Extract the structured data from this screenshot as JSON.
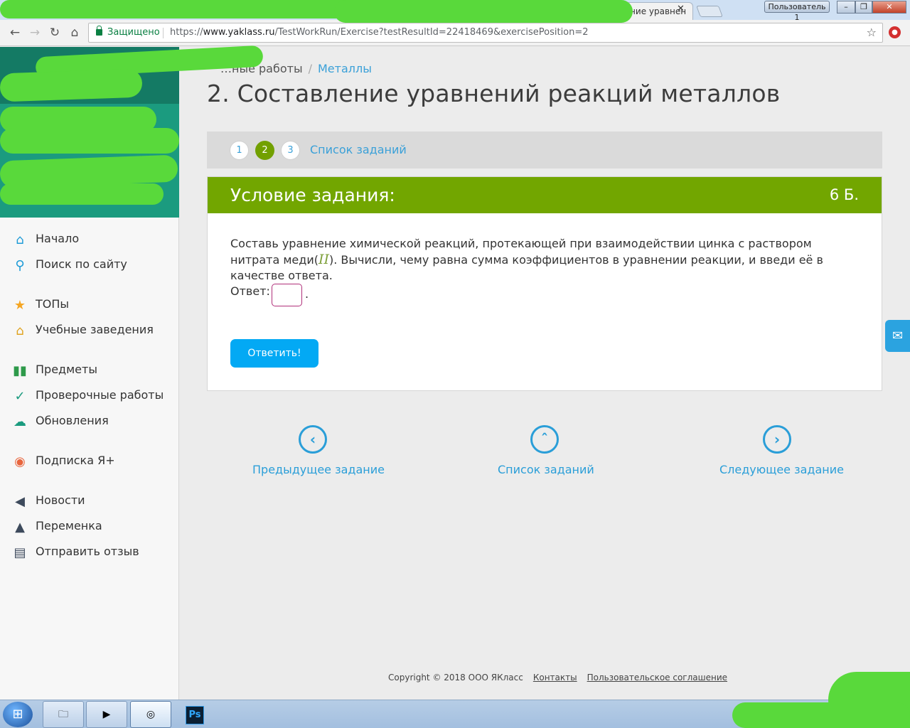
{
  "browser": {
    "tab_title": "2. Составление уравнен",
    "tab_close": "✕",
    "user_label": "Пользователь 1",
    "secure_label": "Защищено",
    "url_scheme": "https://",
    "url_host": "www.yaklass.ru",
    "url_path": "/TestWorkRun/Exercise?testResultId=22418469&exercisePosition=2"
  },
  "sidebar": {
    "items": [
      {
        "label": "Начало",
        "icon": "home-icon"
      },
      {
        "label": "Поиск по сайту",
        "icon": "search-icon"
      },
      {
        "label": "ТОПы",
        "icon": "star-icon"
      },
      {
        "label": "Учебные заведения",
        "icon": "institution-icon"
      },
      {
        "label": "Предметы",
        "icon": "books-icon"
      },
      {
        "label": "Проверочные работы",
        "icon": "check-circle-icon"
      },
      {
        "label": "Обновления",
        "icon": "cloud-sync-icon"
      },
      {
        "label": "Подписка Я+",
        "icon": "ya-plus-icon"
      },
      {
        "label": "Новости",
        "icon": "megaphone-icon"
      },
      {
        "label": "Переменка",
        "icon": "bell-icon"
      },
      {
        "label": "Отправить отзыв",
        "icon": "feedback-icon"
      }
    ]
  },
  "breadcrumb": {
    "parent": "…ные работы",
    "current": "Металлы"
  },
  "page_title": "2. Составление уравнений реакций металлов",
  "steps": {
    "items": [
      "1",
      "2",
      "3"
    ],
    "current": "2",
    "list_link": "Список заданий"
  },
  "task": {
    "header": "Условие задания:",
    "points": "6 Б.",
    "text_before": "Составь уравнение химической реакций, протекающей при взаимодействии цинка с раствором нитрата меди(",
    "roman": "II",
    "text_after": "). Вычисли, чему равна сумма коэффициентов в уравнении реакции, и введи её в качестве ответа.",
    "answer_label": "Ответ:",
    "answer_value": "",
    "answer_suffix": ".",
    "submit_label": "Ответить!"
  },
  "pager": {
    "prev": "Предыдущее задание",
    "list": "Список заданий",
    "next": "Следующее задание"
  },
  "footer": {
    "copyright": "Copyright © 2018 ООО ЯКласс",
    "contacts": "Контакты",
    "agreement": "Пользовательское соглашение"
  },
  "taskbar": {
    "photoshop_label": "Ps"
  },
  "colors": {
    "accent_green": "#72a600",
    "link_blue": "#3aa0d8",
    "button_blue": "#03a9f4",
    "sidebar_teal": "#1b9b7f"
  }
}
